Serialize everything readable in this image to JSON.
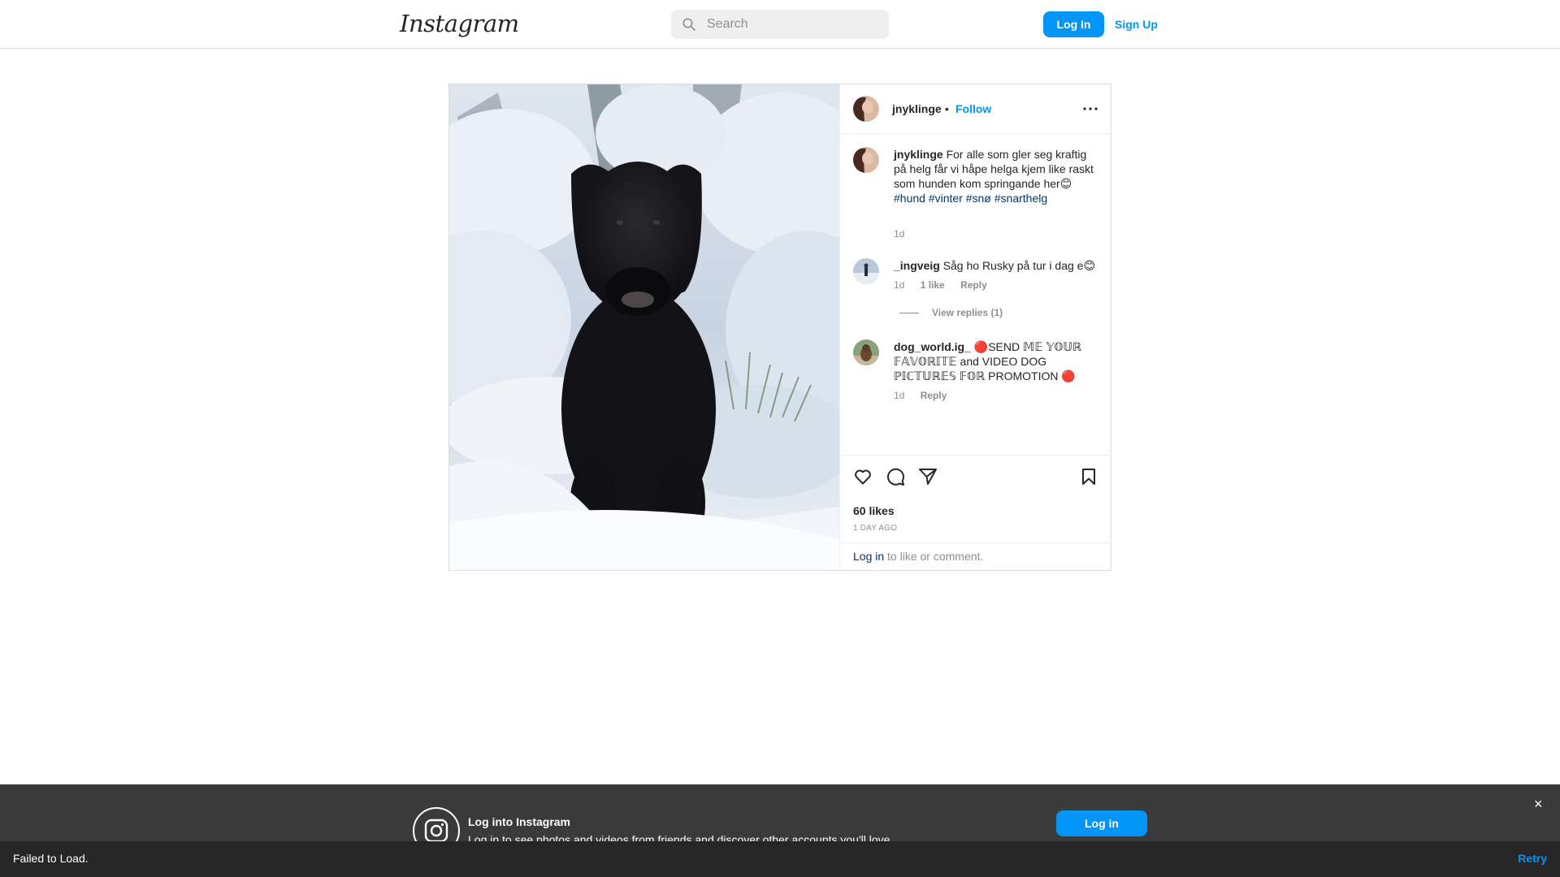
{
  "nav": {
    "logo": "Instagram",
    "search_placeholder": "Search",
    "login_label": "Log In",
    "signup_label": "Sign Up"
  },
  "post": {
    "author": "jnyklinge",
    "dot": "•",
    "follow_label": "Follow",
    "caption": {
      "username": "jnyklinge",
      "text": "For alle som gler seg kraftig på helg får vi håpe helga kjem like raskt som hunden kom springande her😊",
      "hashtags": "#hund #vinter #snø #snarthelg",
      "time": "1d"
    },
    "comments": [
      {
        "username": "_ingveig",
        "text": "Såg ho Rusky på tur i dag e😊",
        "time": "1d",
        "likes": "1 like",
        "reply_label": "Reply"
      },
      {
        "username": "dog_world.ig_",
        "text": "🔴SEND 𝕄𝔼 𝕐𝕆𝕌ℝ 𝔽𝔸𝕍𝕆ℝ𝕀𝕋𝔼 and VIDEO DOG ℙ𝕀ℂ𝕋𝕌ℝ𝔼𝕊 𝔽𝕆ℝ PROMOTION 🔴",
        "time": "1d",
        "reply_label": "Reply"
      }
    ],
    "view_replies": "View replies (1)",
    "likes": "60 likes",
    "time_ago": "1 DAY AGO",
    "login_link": "Log in",
    "login_rest": " to like or comment."
  },
  "banner": {
    "title": "Log into Instagram",
    "subtitle": "Log in to see photos and videos from friends and discover other accounts you'll love.",
    "button": "Log in",
    "close": "×"
  },
  "status": {
    "message": "Failed to Load.",
    "retry": "Retry"
  },
  "colors": {
    "accent": "#0095f6",
    "hashtag": "#00376b",
    "muted": "#8e8e8e"
  }
}
